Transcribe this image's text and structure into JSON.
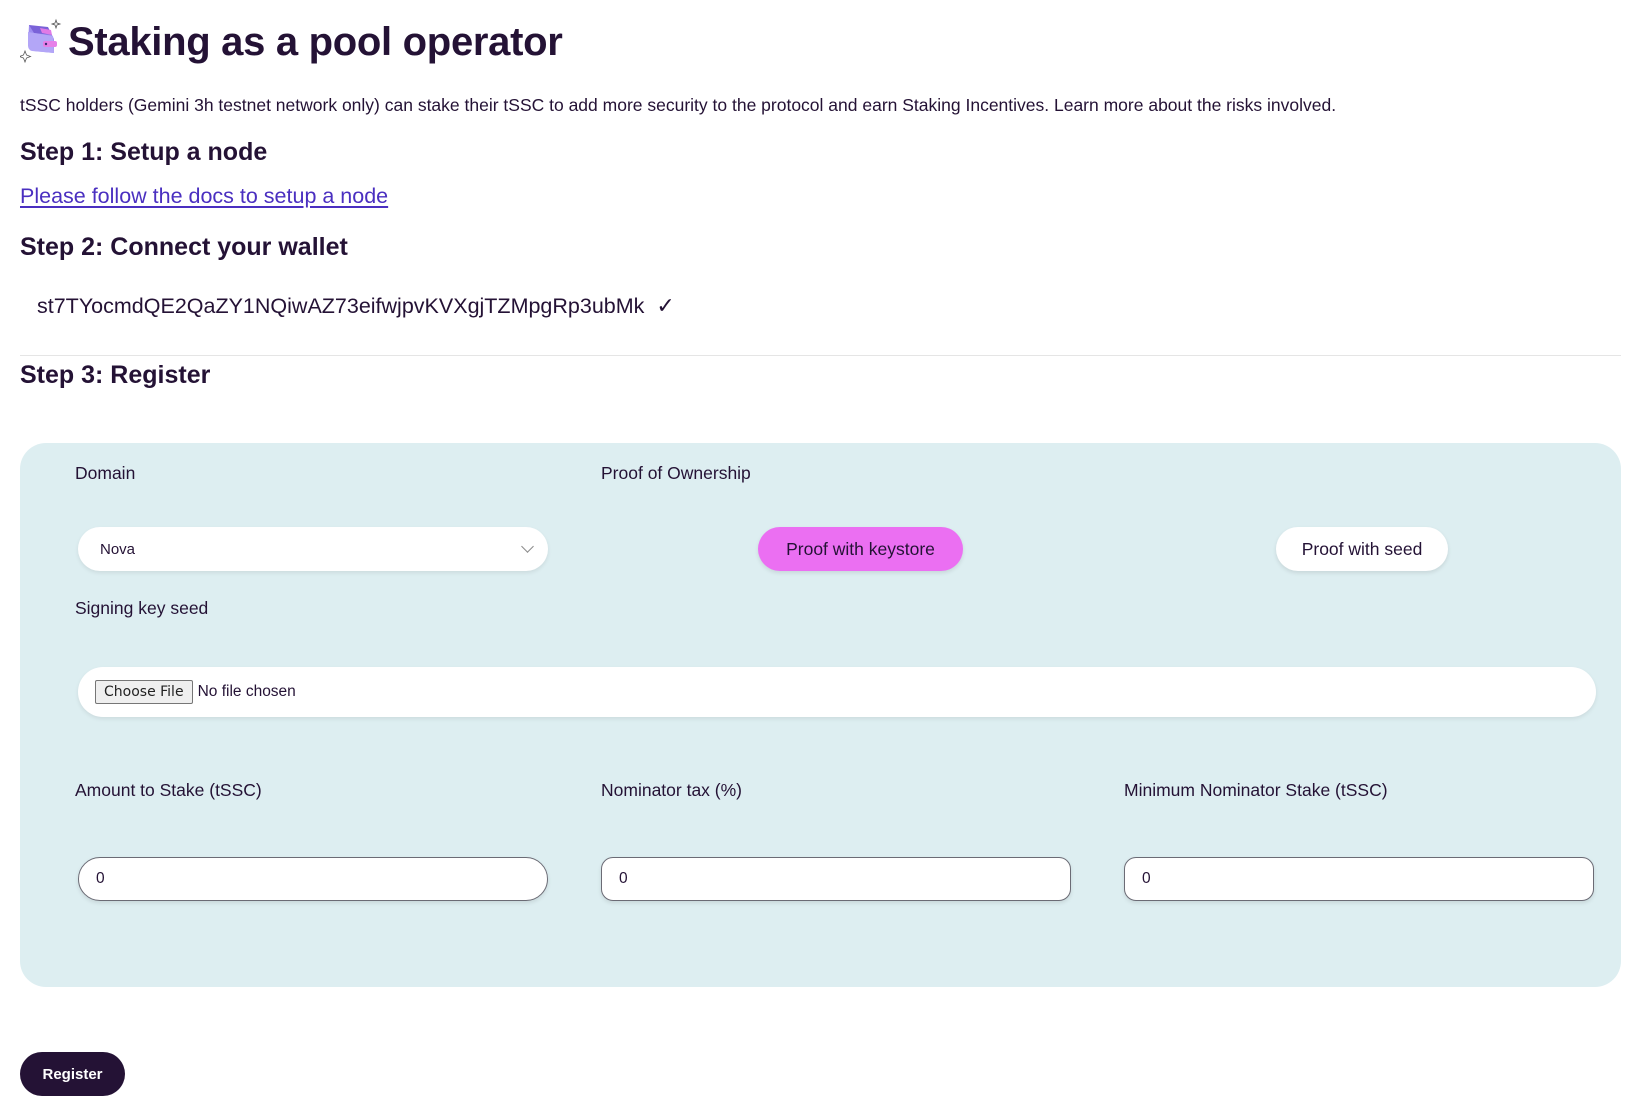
{
  "header": {
    "title": "Staking as a pool operator",
    "icon": "wallet-icon"
  },
  "intro": "tSSC holders (Gemini 3h testnet network only) can stake their tSSC to add more security to the protocol and earn Staking Incentives. Learn more about the risks involved.",
  "step1": {
    "heading": "Step 1: Setup a node",
    "link_label": "Please follow the docs to setup a node"
  },
  "step2": {
    "heading": "Step 2: Connect your wallet",
    "wallet_address": "st7TYocmdQE2QaZY1NQiwAZ73eifwjpvKVXgjTZMpgRp3ubMk",
    "connected_mark": "✓"
  },
  "step3": {
    "heading": "Step 3: Register",
    "domain": {
      "label": "Domain",
      "selected": "Nova"
    },
    "proof": {
      "label": "Proof of Ownership",
      "options": [
        {
          "label": "Proof with keystore",
          "active": true
        },
        {
          "label": "Proof with seed",
          "active": false
        }
      ]
    },
    "signing_key": {
      "label": "Signing key seed",
      "button_label": "Choose File",
      "status": "No file chosen"
    },
    "amount": {
      "label": "Amount to Stake (tSSC)",
      "value": "0"
    },
    "nominator_tax": {
      "label": "Nominator tax (%)",
      "value": "0"
    },
    "min_nominator_stake": {
      "label": "Minimum Nominator Stake (tSSC)",
      "value": "0"
    }
  },
  "register_button": "Register",
  "colors": {
    "text": "#241235",
    "link": "#4a2fc0",
    "panel": "#ddeef1",
    "active_pill": "#eb6ff2",
    "primary_button": "#241235"
  }
}
